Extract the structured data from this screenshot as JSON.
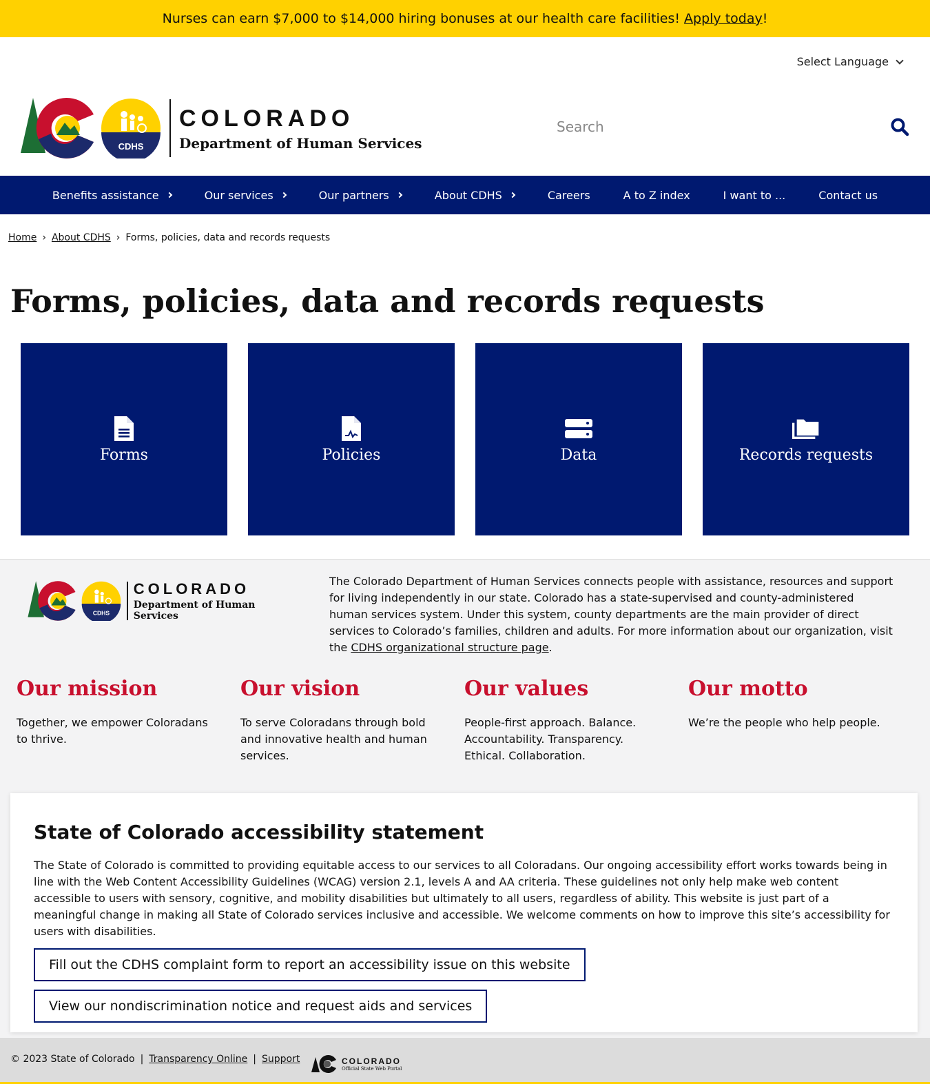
{
  "alert": {
    "text": "Nurses can earn $7,000 to $14,000 hiring bonuses at our health care facilities!",
    "link": "Apply today",
    "suffix": "!"
  },
  "language": {
    "label": "Select Language"
  },
  "logo": {
    "state": "COLORADO",
    "department": "Department of Human Services",
    "seal_text": "CDHS"
  },
  "search": {
    "placeholder": "Search"
  },
  "nav": {
    "items": [
      {
        "label": "Benefits assistance",
        "has_children": true
      },
      {
        "label": "Our services",
        "has_children": true
      },
      {
        "label": "Our partners",
        "has_children": true
      },
      {
        "label": "About CDHS",
        "has_children": true
      },
      {
        "label": "Careers",
        "has_children": false
      },
      {
        "label": "A to Z index",
        "has_children": false
      },
      {
        "label": "I want to ...",
        "has_children": false
      },
      {
        "label": "Contact us",
        "has_children": false
      }
    ]
  },
  "breadcrumb": {
    "home": "Home",
    "parent": "About CDHS",
    "current": "Forms, policies, data and records requests",
    "separator": "›"
  },
  "page": {
    "title": "Forms, policies, data and records requests"
  },
  "tiles": [
    {
      "label": "Forms",
      "icon": "file-lines-icon"
    },
    {
      "label": "Policies",
      "icon": "file-signature-icon"
    },
    {
      "label": "Data",
      "icon": "server-icon"
    },
    {
      "label": "Records requests",
      "icon": "folders-icon"
    }
  ],
  "about": {
    "blurb": "The Colorado Department of Human Services connects people with assistance, resources and support for living independently in our state. Colorado has a state-supervised and county-administered human services system. Under this system, county departments are the main provider of direct services to Colorado’s families, children and adults. For more information about our organization, visit the",
    "blurb_link": "CDHS organizational structure page",
    "blurb_end": "."
  },
  "pillars": [
    {
      "title": "Our mission",
      "text": "Together, we empower Coloradans to thrive."
    },
    {
      "title": "Our vision",
      "text": "To serve Coloradans through bold and innovative health and human services."
    },
    {
      "title": "Our values",
      "text": "People-first approach. Balance. Accountability. Transparency. Ethical. Collaboration."
    },
    {
      "title": "Our motto",
      "text": "We’re the people who help people."
    }
  ],
  "accessibility": {
    "title": "State of Colorado accessibility statement",
    "body": "The State of Colorado is committed to providing equitable access to our services to all Coloradans. Our ongoing accessibility effort works towards being in line with the Web Content Accessibility Guidelines (WCAG) version 2.1, levels A and AA criteria. These guidelines not only help make web content accessible to users with sensory, cognitive, and mobility disabilities but ultimately to all users, regardless of ability. This website is just part of a meaningful change in making all State of Colorado services inclusive and accessible. We welcome comments on how to improve this site’s accessibility for users with disabilities.",
    "button_complaint": "Fill out the CDHS complaint form to report an accessibility issue on this website",
    "button_nondiscrimination": "View our nondiscrimination notice and request aids and services"
  },
  "footer": {
    "copyright": "© 2023 State of Colorado",
    "sep": "|",
    "transparency": "Transparency Online",
    "support": "Support",
    "portal_name": "COLORADO",
    "portal_sub": "Official State Web Portal"
  },
  "colors": {
    "navy": "#001970",
    "gold": "#ffd100",
    "red": "#c8102e",
    "green": "#1d6e34"
  }
}
